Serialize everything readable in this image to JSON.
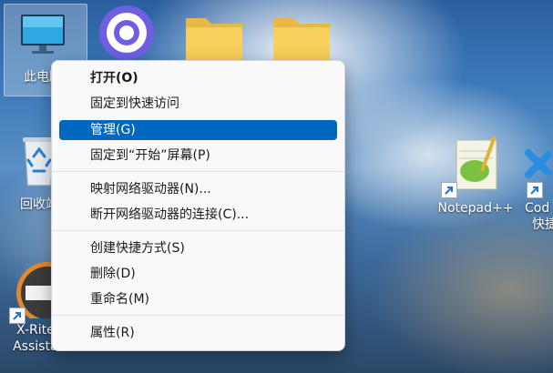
{
  "desktop": {
    "icons": [
      {
        "label": "此电脑",
        "icon": "computer-icon"
      },
      {
        "label": "",
        "icon": "browser-icon"
      },
      {
        "label": "",
        "icon": "folder-icon"
      },
      {
        "label": "",
        "icon": "folder-icon"
      },
      {
        "label": "回收站",
        "icon": "recycle-bin-icon"
      },
      {
        "label": "X-Rite C",
        "label2": "Assistant",
        "icon": "xrite-icon"
      },
      {
        "label": "Notepad++",
        "icon": "notepad-plus-plus-icon"
      },
      {
        "label": "Cod",
        "label2": "快捷",
        "icon": "vscode-icon"
      }
    ]
  },
  "context_menu": {
    "items": [
      {
        "label": "打开(O)",
        "bold": true
      },
      {
        "label": "固定到快速访问"
      },
      {
        "label": "管理(G)",
        "active": true
      },
      {
        "label": "固定到“开始”屏幕(P)"
      },
      {
        "label": "映射网络驱动器(N)..."
      },
      {
        "label": "断开网络驱动器的连接(C)..."
      },
      {
        "label": "创建快捷方式(S)"
      },
      {
        "label": "删除(D)"
      },
      {
        "label": "重命名(M)"
      },
      {
        "label": "属性(R)"
      }
    ]
  },
  "colors": {
    "menu_highlight": "#0067c0",
    "menu_background": "#f9f9f9"
  }
}
